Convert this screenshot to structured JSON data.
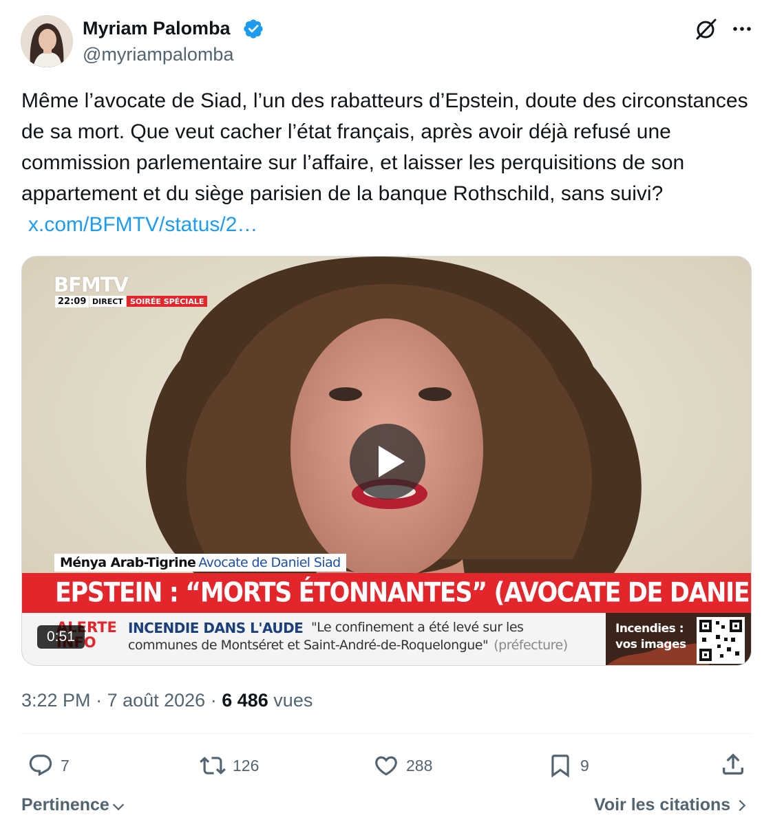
{
  "author": {
    "name": "Myriam Palomba",
    "handle": "@myriampalomba",
    "verified": true
  },
  "icons": {
    "verified": "verified-badge-icon",
    "grok": "grok-icon",
    "more": "more-options-icon",
    "reply": "reply-icon",
    "retweet": "retweet-icon",
    "like": "like-icon",
    "bookmark": "bookmark-icon",
    "share": "share-icon",
    "play": "play-icon"
  },
  "tweet": {
    "text": "Même l’avocate de Siad, l’un des rabatteurs d’Epstein, doute des circonstances de sa mort. Que veut cacher l’état français, après avoir déjà refusé une commission parlementaire sur l’affaire, et laisser les perquisitions de son appartement et du siège parisien de la banque Rothschild, sans suivi?",
    "link": "x.com/BFMTV/status/2…"
  },
  "video": {
    "duration": "0:51",
    "channel": "BFMTV",
    "time": "22:09",
    "direct": "DIRECT",
    "special": "SOIRÉE SPÉCIALE",
    "person_name": "Ménya Arab-Tigrine",
    "person_role": "Avocate de Daniel Siad",
    "headline": "EPSTEIN : “MORTS ÉTONNANTES” (AVOCATE DE DANIEL SIAD)",
    "alert_line1": "ALERTE",
    "alert_line2": "INFO",
    "ticker_title": "INCENDIE DANS L'AUDE",
    "ticker_quote": "\"Le confinement a été levé sur les",
    "ticker_line2": "communes de Montséret et Saint-André-de-Roquelongue\"",
    "ticker_source": "(préfecture)",
    "promo_line1": "Incendies :",
    "promo_line2": "vos images"
  },
  "meta": {
    "time": "3:22 PM",
    "separator": " · ",
    "date": "7 août 2026",
    "views_count": "6 486",
    "views_label": "vues"
  },
  "actions": {
    "replies": "7",
    "retweets": "126",
    "likes": "288",
    "bookmarks": "9"
  },
  "footer": {
    "sort_label": "Pertinence",
    "quotes_label": "Voir les citations"
  },
  "colors": {
    "link": "#1d9bf0",
    "verified": "#1d9bf0",
    "secondary_text": "#536471",
    "bfm_red": "#e3262c"
  }
}
